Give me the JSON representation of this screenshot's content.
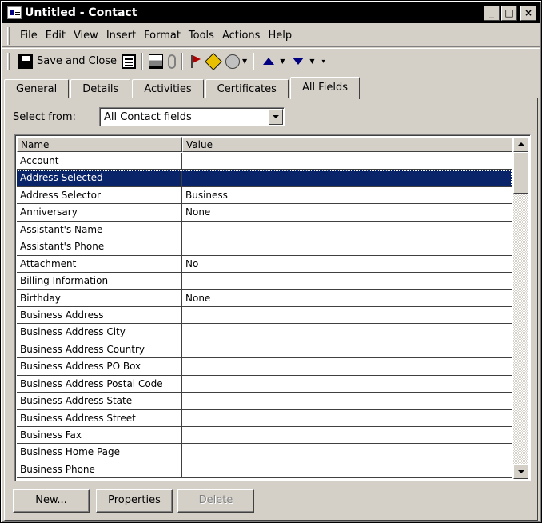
{
  "window": {
    "title": "Untitled - Contact",
    "controls": {
      "minimize": "_",
      "maximize": "□",
      "close": "×"
    }
  },
  "menubar": {
    "items": [
      "File",
      "Edit",
      "View",
      "Insert",
      "Format",
      "Tools",
      "Actions",
      "Help"
    ]
  },
  "toolbar": {
    "save_close_label": "Save and Close",
    "icons": [
      "save-icon",
      "contact-card-icon",
      "print-icon",
      "paperclip-icon",
      "flag-icon",
      "diamond-icon",
      "phone-icon",
      "arrow-up-icon",
      "arrow-down-icon"
    ]
  },
  "tabs": {
    "items": [
      "General",
      "Details",
      "Activities",
      "Certificates",
      "All Fields"
    ],
    "active": "All Fields"
  },
  "select_from": {
    "label": "Select from:",
    "value": "All Contact fields"
  },
  "grid": {
    "columns": [
      "Name",
      "Value"
    ],
    "rows": [
      {
        "name": "Account",
        "value": ""
      },
      {
        "name": "Address Selected",
        "value": ""
      },
      {
        "name": "Address Selector",
        "value": "Business"
      },
      {
        "name": "Anniversary",
        "value": "None"
      },
      {
        "name": "Assistant's Name",
        "value": ""
      },
      {
        "name": "Assistant's Phone",
        "value": ""
      },
      {
        "name": "Attachment",
        "value": "No"
      },
      {
        "name": "Billing Information",
        "value": ""
      },
      {
        "name": "Birthday",
        "value": "None"
      },
      {
        "name": "Business Address",
        "value": ""
      },
      {
        "name": "Business Address City",
        "value": ""
      },
      {
        "name": "Business Address Country",
        "value": ""
      },
      {
        "name": "Business Address PO Box",
        "value": ""
      },
      {
        "name": "Business Address Postal Code",
        "value": ""
      },
      {
        "name": "Business Address State",
        "value": ""
      },
      {
        "name": "Business Address Street",
        "value": ""
      },
      {
        "name": "Business Fax",
        "value": ""
      },
      {
        "name": "Business Home Page",
        "value": ""
      },
      {
        "name": "Business Phone",
        "value": ""
      }
    ],
    "selected_row": "Address Selected"
  },
  "buttons": {
    "new": "New...",
    "properties": "Properties",
    "delete": "Delete"
  },
  "colors": {
    "selection": "#0a246a",
    "face": "#d4d0c8",
    "titlebar": "#000000"
  }
}
